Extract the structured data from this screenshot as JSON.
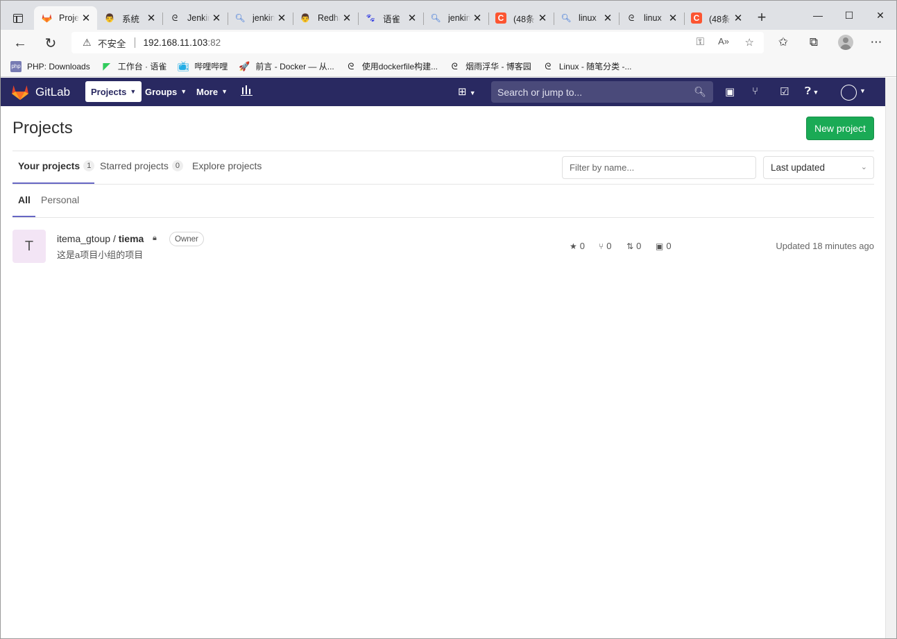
{
  "browser": {
    "tabs": [
      {
        "title": "Projects",
        "icon": "gitlab-fox-icon",
        "active": true
      },
      {
        "title": "系统",
        "icon": "jenkins-avatar-icon"
      },
      {
        "title": "Jenkins",
        "icon": "cnblogs-icon"
      },
      {
        "title": "jenkins",
        "icon": "search-icon"
      },
      {
        "title": "Redhat",
        "icon": "jenkins-avatar-icon"
      },
      {
        "title": "语雀",
        "icon": "baidu-icon"
      },
      {
        "title": "jenkins",
        "icon": "search-icon"
      },
      {
        "title": "(48条",
        "icon": "csdn-icon"
      },
      {
        "title": "linux",
        "icon": "search-icon"
      },
      {
        "title": "linux",
        "icon": "cnblogs-icon"
      },
      {
        "title": "(48条",
        "icon": "csdn-icon"
      }
    ],
    "address": {
      "security_label": "不安全",
      "host": "192.168.11.103",
      "port": ":82"
    },
    "bookmarks": [
      {
        "label": "PHP: Downloads",
        "icon": "php-icon"
      },
      {
        "label": "工作台 · 语雀",
        "icon": "yuque-icon"
      },
      {
        "label": "哔哩哔哩",
        "icon": "bilibili-icon"
      },
      {
        "label": "前言 - Docker — 从...",
        "icon": "rocket-icon"
      },
      {
        "label": "使用dockerfile构建...",
        "icon": "cnblogs-icon"
      },
      {
        "label": "烟雨浮华 - 博客园",
        "icon": "cnblogs-icon"
      },
      {
        "label": "Linux - 随笔分类 -...",
        "icon": "cnblogs-icon"
      }
    ]
  },
  "gitlab": {
    "brand": "GitLab",
    "menu": {
      "projects": "Projects",
      "groups": "Groups",
      "more": "More"
    },
    "search_placeholder": "Search or jump to..."
  },
  "page": {
    "title": "Projects",
    "new_project_label": "New project",
    "tabs": [
      {
        "label": "Your projects",
        "count": "1"
      },
      {
        "label": "Starred projects",
        "count": "0"
      },
      {
        "label": "Explore projects",
        "count": ""
      }
    ],
    "filter_placeholder": "Filter by name...",
    "sort_label": "Last updated",
    "subtabs": [
      "All",
      "Personal"
    ],
    "project": {
      "avatar_letter": "T",
      "namespace": "itema_gtoup / ",
      "name": "tiema",
      "role": "Owner",
      "description": "这是a项目小组的项目",
      "stars": "0",
      "forks": "0",
      "merge_requests": "0",
      "issues": "0",
      "updated": "Updated 18 minutes ago"
    }
  },
  "colors": {
    "navbar": "#292961",
    "new_button": "#1aaa55",
    "tab_underline": "#6666c4",
    "avatar_bg": "#f3e5f5"
  }
}
